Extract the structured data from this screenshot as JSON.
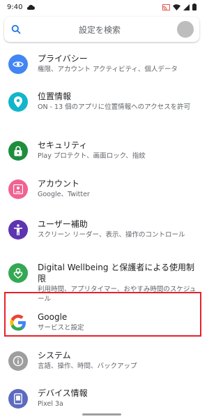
{
  "status": {
    "time": "9:40"
  },
  "search": {
    "placeholder": "設定を検索"
  },
  "items": [
    {
      "title": "プライバシー",
      "subtitle": "権限、アカウント アクティビティ、個人データ",
      "color": "#4285f4",
      "icon": "privacy-eye-icon"
    },
    {
      "title": "位置情報",
      "subtitle": "ON - 13 個のアプリに位置情報へのアクセスを許可",
      "color": "#12b5cb",
      "icon": "location-pin-icon"
    },
    {
      "title": "セキュリティ",
      "subtitle": "Play プロテクト、画面ロック、指紋",
      "color": "#1e8e3e",
      "icon": "lock-icon"
    },
    {
      "title": "アカウント",
      "subtitle": "Google、Twitter",
      "color": "#f06292",
      "icon": "account-icon"
    },
    {
      "title": "ユーザー補助",
      "subtitle": "スクリーン リーダー、表示、操作のコントロール",
      "color": "#5e35b1",
      "icon": "accessibility-icon"
    },
    {
      "title": "Digital Wellbeing と保護者による使用制限",
      "subtitle": "利用時間、アプリタイマー、おやすみ時間のスケジュール",
      "color": "#34a853",
      "icon": "wellbeing-heart-icon"
    },
    {
      "title": "Google",
      "subtitle": "サービスと設定",
      "color": "#ffffff",
      "icon": "google-g-icon"
    },
    {
      "title": "システム",
      "subtitle": "言語、操作、時間、バックアップ",
      "color": "#9e9e9e",
      "icon": "info-icon"
    },
    {
      "title": "デバイス情報",
      "subtitle": "Pixel 3a",
      "color": "#5c6bc0",
      "icon": "device-phone-icon"
    }
  ],
  "colors": {
    "highlight": "#e8202a"
  }
}
